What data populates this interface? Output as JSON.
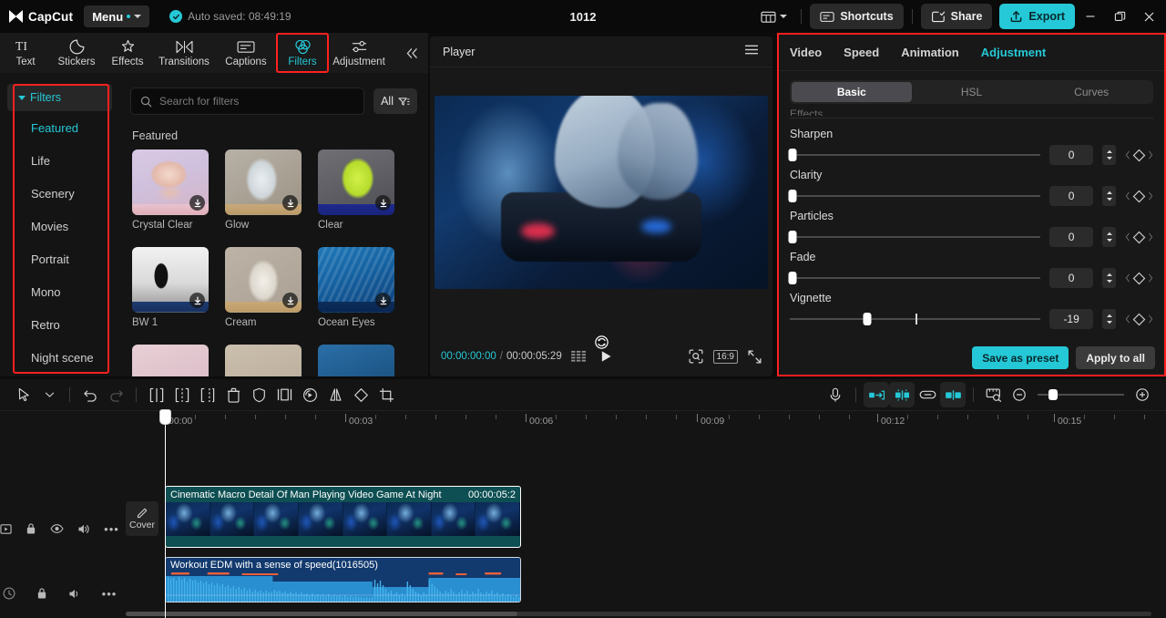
{
  "titlebar": {
    "brand": "CapCut",
    "menu_label": "Menu",
    "autosave": "Auto saved: 08:49:19",
    "project_title": "1012",
    "layout_icon": "layout-icon",
    "shortcuts_label": "Shortcuts",
    "share_label": "Share",
    "export_label": "Export",
    "minimize_icon": "minimize-icon",
    "maximize_icon": "maximize-icon",
    "close_icon": "close-icon",
    "accent": "#25c8d6"
  },
  "tooltabs": {
    "items": [
      {
        "label": "Text",
        "icon": "text-icon"
      },
      {
        "label": "Stickers",
        "icon": "sticker-icon"
      },
      {
        "label": "Effects",
        "icon": "effects-icon"
      },
      {
        "label": "Transitions",
        "icon": "transitions-icon"
      },
      {
        "label": "Captions",
        "icon": "captions-icon"
      },
      {
        "label": "Filters",
        "icon": "filters-icon"
      },
      {
        "label": "Adjustment",
        "icon": "adjustment-icon"
      }
    ],
    "active": "Filters",
    "collapse_icon": "chevron-double-left-icon"
  },
  "categories": {
    "header": "Filters",
    "items": [
      "Featured",
      "Life",
      "Scenery",
      "Movies",
      "Portrait",
      "Mono",
      "Retro",
      "Night scene"
    ],
    "active": "Featured"
  },
  "browser": {
    "search_placeholder": "Search for filters",
    "search_value": "",
    "filter_button": "All",
    "section_title": "Featured",
    "filters": [
      {
        "name": "Crystal Clear",
        "thumb": "th-crystal"
      },
      {
        "name": "Glow",
        "thumb": "th-glow"
      },
      {
        "name": "Clear",
        "thumb": "th-clear"
      },
      {
        "name": "BW 1",
        "thumb": "th-bw"
      },
      {
        "name": "Cream",
        "thumb": "th-cream"
      },
      {
        "name": "Ocean Eyes",
        "thumb": "th-ocean"
      }
    ]
  },
  "player": {
    "title": "Player",
    "menu_icon": "hamburger-icon",
    "rotate_icon": "rotate-icon",
    "current_time": "00:00:00:00",
    "separator": "/",
    "total_time": "00:00:05:29",
    "frames_icon": "frames-icon",
    "play_icon": "play-icon",
    "crop_icon": "crop-preview-icon",
    "ratio_label": "16:9",
    "fullscreen_icon": "fullscreen-icon"
  },
  "adjustment": {
    "tabs": [
      "Video",
      "Speed",
      "Animation",
      "Adjustment"
    ],
    "active_tab": "Adjustment",
    "segments": [
      "Basic",
      "HSL",
      "Curves"
    ],
    "active_segment": "Basic",
    "scrolled_label": "Effects",
    "rows": [
      {
        "name": "Sharpen",
        "value": "0",
        "pos": 0,
        "centered": false
      },
      {
        "name": "Clarity",
        "value": "0",
        "pos": 0,
        "centered": false
      },
      {
        "name": "Particles",
        "value": "0",
        "pos": 0,
        "centered": false
      },
      {
        "name": "Fade",
        "value": "0",
        "pos": 0,
        "centered": false
      },
      {
        "name": "Vignette",
        "value": "-19",
        "pos": 31,
        "centered": true
      }
    ],
    "save_preset_label": "Save as preset",
    "apply_all_label": "Apply to all"
  },
  "timeline": {
    "toolbar_left": [
      "select-icon",
      "chevron-down-icon",
      "undo-icon",
      "redo-icon",
      "split-icon",
      "split-left-icon",
      "split-right-icon",
      "delete-icon",
      "mask-icon",
      "freeze-icon",
      "reverse-icon",
      "mirror-icon",
      "rotate-clip-icon",
      "crop-icon"
    ],
    "toolbar_right": [
      "mic-icon",
      "auto-cut-icon",
      "snap-icon",
      "link-icon",
      "mix-icon",
      "preview-ruler-icon",
      "zoom-out-icon",
      "zoom-slider",
      "zoom-in-icon"
    ],
    "ruler_labels": [
      "00:00",
      "00:03",
      "00:06",
      "00:09",
      "00:12",
      "00:15"
    ],
    "video_track_icons": [
      "mute-video-icon",
      "lock-icon",
      "eye-icon",
      "volume-icon",
      "more-icon"
    ],
    "audio_track_icons": [
      "metronome-icon",
      "lock-icon",
      "volume-icon",
      "more-icon"
    ],
    "cover_label": "Cover",
    "cover_icon": "pencil-icon",
    "video_clip": {
      "title": "Cinematic Macro Detail Of Man Playing Video Game At Night",
      "duration": "00:00:05:2"
    },
    "audio_clip": {
      "title": "Workout EDM with a sense of speed(1016505)"
    }
  }
}
